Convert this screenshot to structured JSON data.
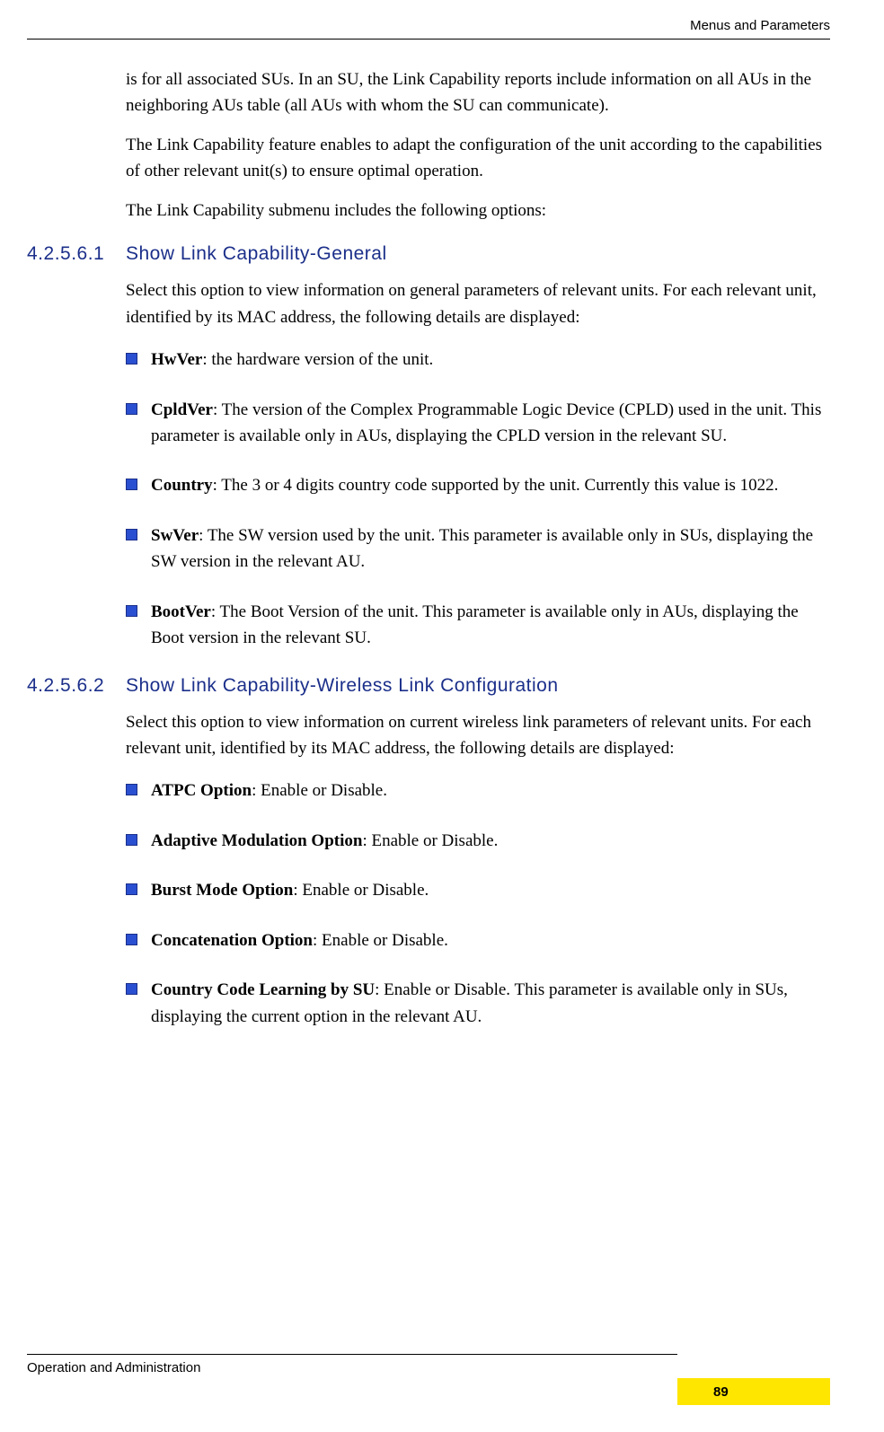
{
  "header": "Menus and Parameters",
  "intro": {
    "p1": "is for all associated SUs. In an SU, the Link Capability reports include information on all AUs in the neighboring AUs table (all AUs with whom the SU can communicate).",
    "p2": "The Link Capability feature enables to adapt the configuration of the unit according to the capabilities of other relevant unit(s) to ensure optimal operation.",
    "p3": "The Link Capability submenu includes the following options:"
  },
  "sec1": {
    "num": "4.2.5.6.1",
    "title": "Show Link Capability-General",
    "intro": "Select this option to view information on general parameters of relevant units. For each relevant unit, identified by its MAC address, the following details are displayed:",
    "items": [
      {
        "term": "HwVer",
        "desc": ": the hardware version of the unit."
      },
      {
        "term": "CpldVer",
        "desc": ": The version of the Complex Programmable Logic Device (CPLD) used in the unit. This parameter is available only in AUs, displaying the CPLD version in the relevant SU."
      },
      {
        "term": "Country",
        "desc": ": The 3 or 4 digits country code supported by the unit. Currently this value is 1022."
      },
      {
        "term": " SwVer",
        "desc": ": The SW version used by the unit. This parameter is available only in SUs, displaying the SW version in the relevant AU."
      },
      {
        "term": "BootVer",
        "desc": ": The Boot Version of the unit. This parameter is available only in AUs, displaying the Boot version in the relevant SU."
      }
    ]
  },
  "sec2": {
    "num": "4.2.5.6.2",
    "title": "Show Link Capability-Wireless Link Configuration",
    "intro": "Select this option to view information on current wireless link parameters of relevant units. For each relevant unit, identified by its MAC address, the following details are displayed:",
    "items": [
      {
        "term": "ATPC Option",
        "desc": ": Enable or Disable."
      },
      {
        "term": "Adaptive Modulation Option",
        "desc": ": Enable or Disable."
      },
      {
        "term": "Burst Mode Option",
        "desc": ": Enable or Disable."
      },
      {
        "term": "Concatenation Option",
        "desc": ": Enable or Disable."
      },
      {
        "term": "Country Code Learning by SU",
        "desc": ": Enable or Disable. This parameter is available only in SUs, displaying the current option in the relevant AU."
      }
    ]
  },
  "footer": {
    "left": "Operation and Administration",
    "page": "89"
  }
}
